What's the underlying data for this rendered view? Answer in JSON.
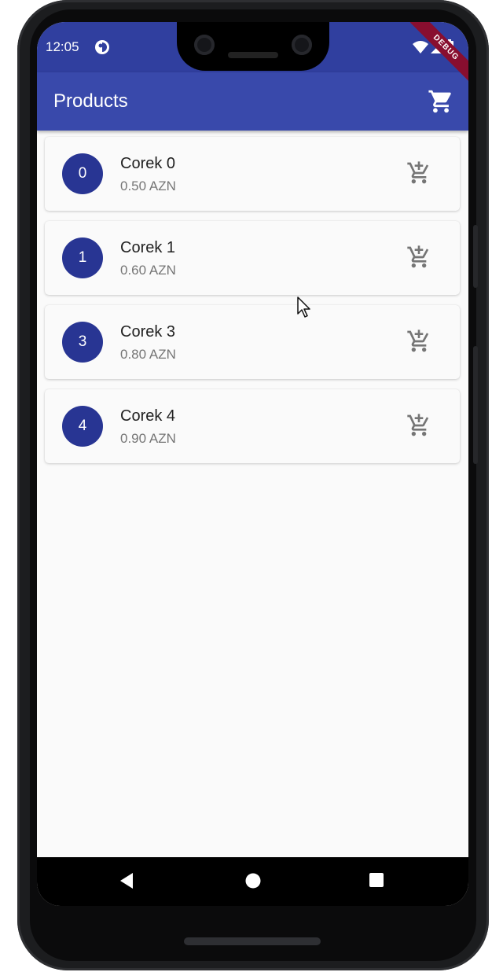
{
  "status": {
    "time": "12:05"
  },
  "appbar": {
    "title": "Products",
    "debug_banner": "DEBUG"
  },
  "products": [
    {
      "avatar": "0",
      "name": "Corek 0",
      "price": "0.50 AZN"
    },
    {
      "avatar": "1",
      "name": "Corek 1",
      "price": "0.60 AZN"
    },
    {
      "avatar": "3",
      "name": "Corek 3",
      "price": "0.80 AZN"
    },
    {
      "avatar": "4",
      "name": "Corek 4",
      "price": "0.90 AZN"
    }
  ],
  "icons": {
    "appbar_action": "shopping-cart-icon",
    "item_action": "add-shopping-cart-icon",
    "nav": [
      "back-triangle-icon",
      "home-circle-icon",
      "recents-square-icon"
    ]
  },
  "colors": {
    "status_bar": "#303f9f",
    "app_bar": "#3949ab",
    "avatar": "#283593",
    "background": "#fafafa"
  }
}
